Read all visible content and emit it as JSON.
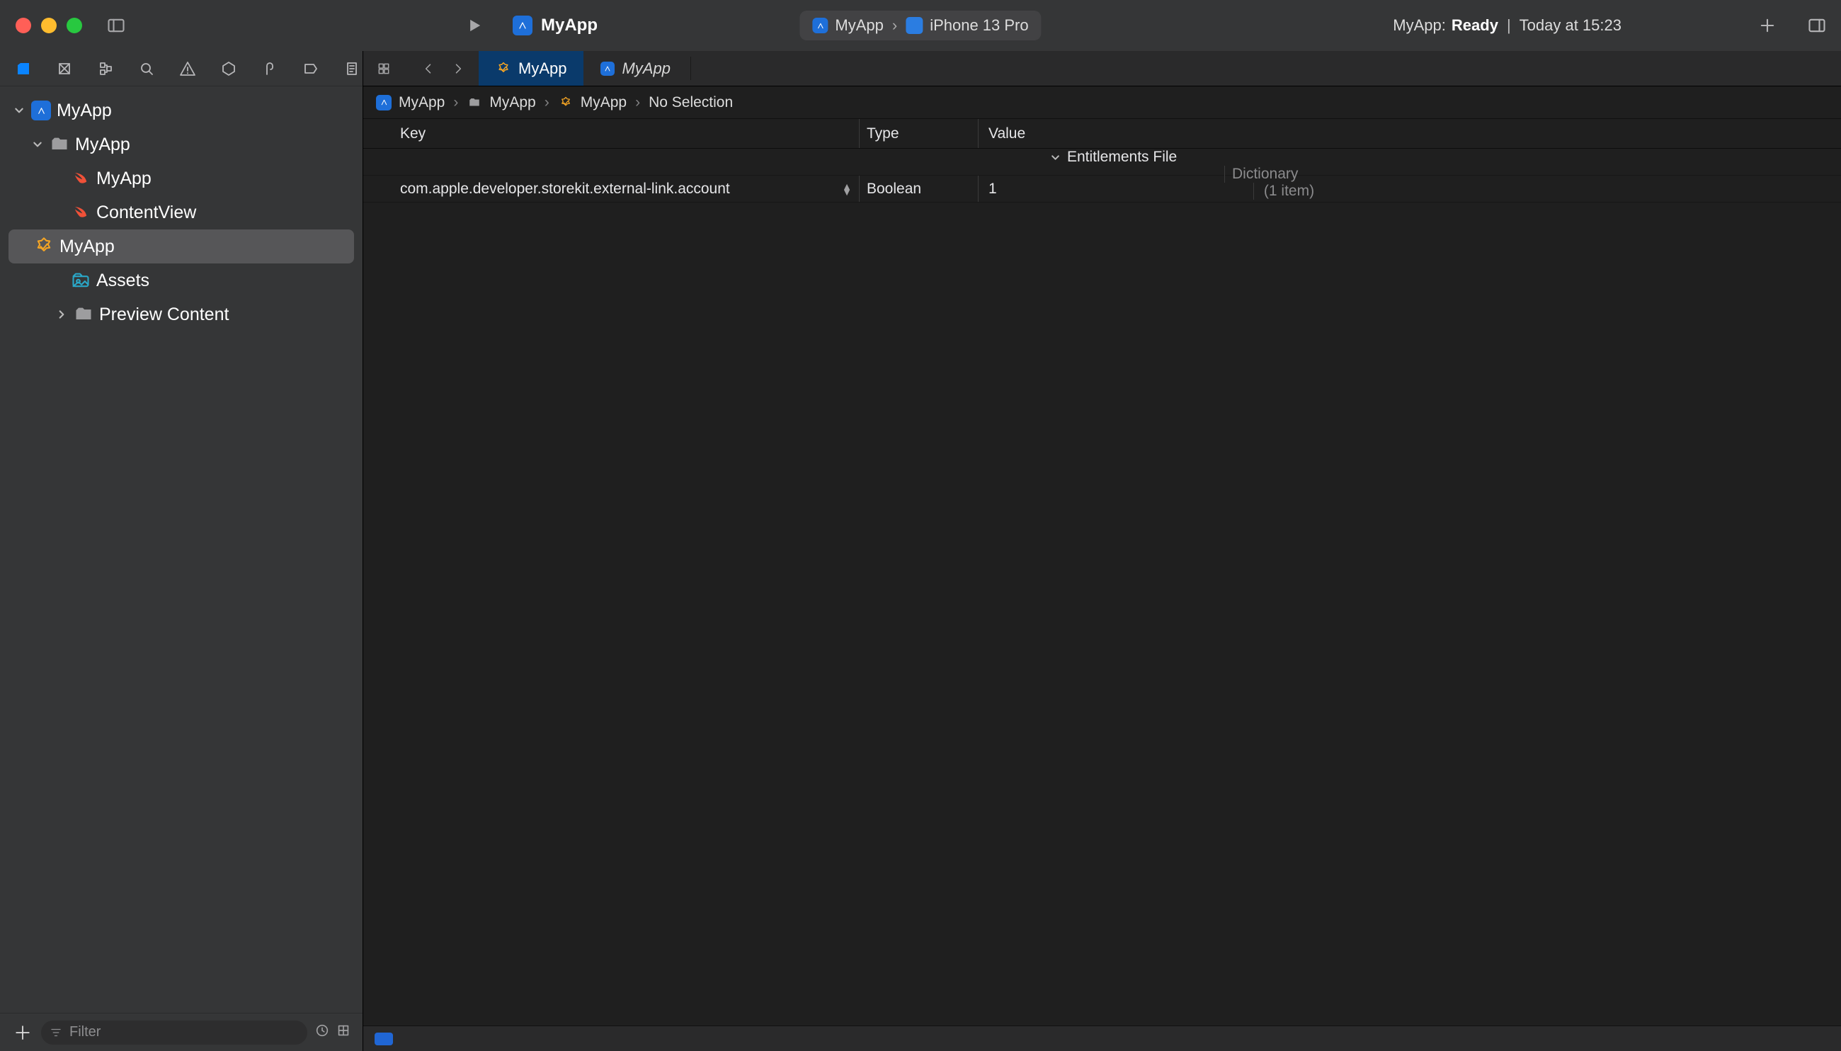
{
  "title": {
    "appName": "MyApp"
  },
  "scheme": {
    "project": "MyApp",
    "device": "iPhone 13 Pro"
  },
  "status": {
    "project": "MyApp:",
    "state": "Ready",
    "time": "Today at 15:23"
  },
  "navigator": {
    "rootProject": "MyApp",
    "group": "MyApp",
    "files": {
      "appSwift": "MyApp",
      "contentView": "ContentView",
      "entitlements": "MyApp",
      "assets": "Assets",
      "previewContent": "Preview Content"
    },
    "filterPlaceholder": "Filter"
  },
  "editorTabs": {
    "active": "MyApp",
    "secondary": "MyApp"
  },
  "jumpbar": {
    "p1": "MyApp",
    "p2": "MyApp",
    "p3": "MyApp",
    "p4": "No Selection"
  },
  "plist": {
    "headerKey": "Key",
    "headerType": "Type",
    "headerValue": "Value",
    "root": {
      "key": "Entitlements File",
      "type": "Dictionary",
      "value": "(1 item)"
    },
    "child": {
      "key": "com.apple.developer.storekit.external-link.account",
      "type": "Boolean",
      "value": "1"
    }
  }
}
